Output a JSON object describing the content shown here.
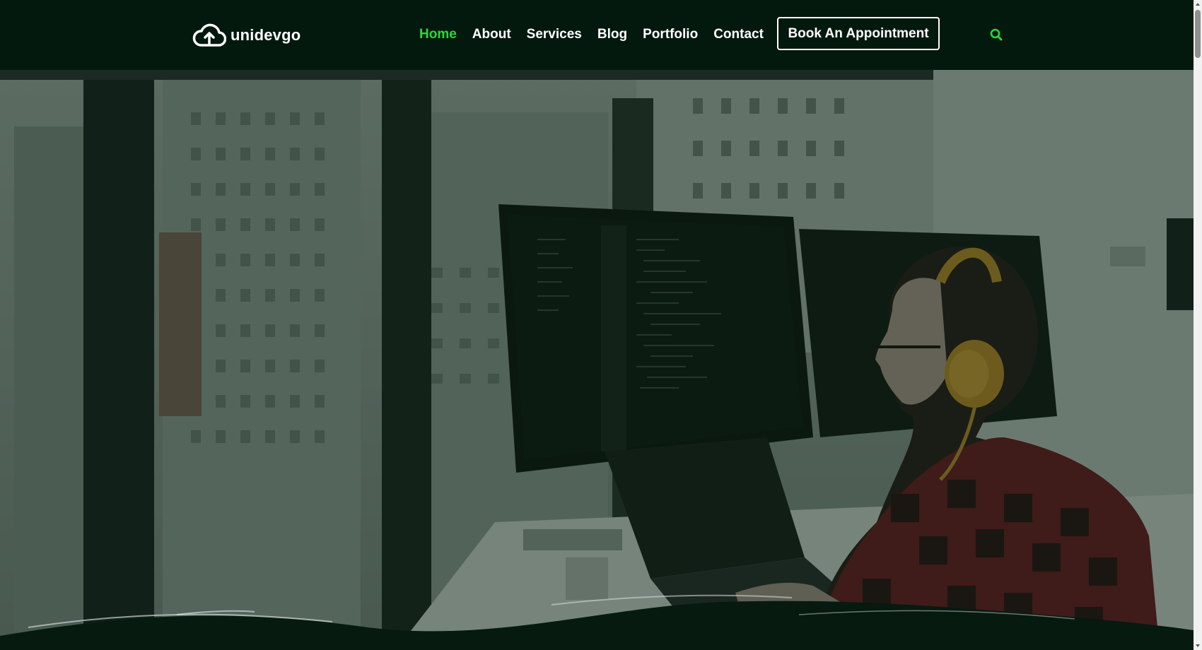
{
  "brand": {
    "name": "unidevgo",
    "logo_icon": "cloud-upload-icon"
  },
  "nav": {
    "items": [
      {
        "label": "Home",
        "active": true
      },
      {
        "label": "About",
        "active": false
      },
      {
        "label": "Services",
        "active": false
      },
      {
        "label": "Blog",
        "active": false
      },
      {
        "label": "Portfolio",
        "active": false
      },
      {
        "label": "Contact",
        "active": false
      }
    ],
    "cta_label": "Book An Appointment",
    "search_icon": "search-icon"
  },
  "hero": {
    "image": "developer-at-desk-with-monitors",
    "overlay_color": "#041c0e"
  },
  "colors": {
    "header_bg": "#04190e",
    "accent": "#2ed63d",
    "text": "#ffffff"
  }
}
